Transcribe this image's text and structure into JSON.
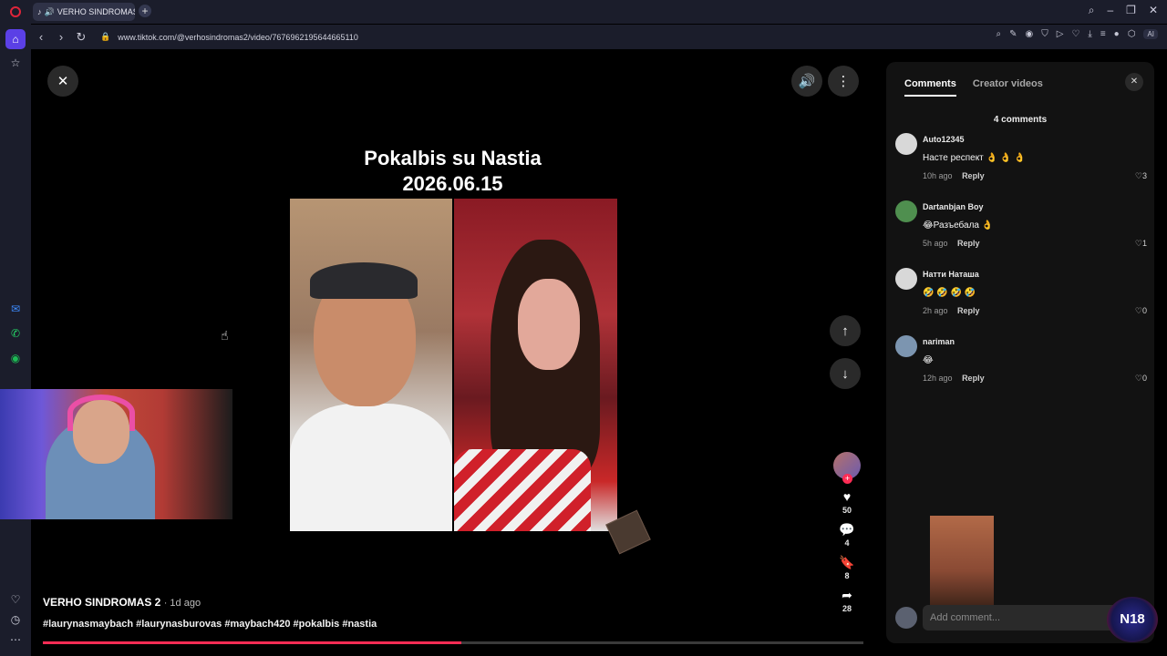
{
  "browser": {
    "tab_title": "VERHO SINDROMAS",
    "url": "www.tiktok.com/@verhosindromas2/video/7676962195644665110",
    "ai_label": "AI"
  },
  "video": {
    "title_line1": "Pokalbis su Nastia",
    "title_line2": "2026.06.15",
    "author": "VERHO SINDROMAS 2",
    "posted": "· 1d ago",
    "hashtags": "#laurynasmaybach #laurynasburovas #maybach420 #pokalbis #nastia",
    "progress": 0.51
  },
  "actions": {
    "likes": "50",
    "comments": "4",
    "saves": "8",
    "shares": "28"
  },
  "comments_panel": {
    "tab_comments": "Comments",
    "tab_creator": "Creator videos",
    "count_label": "4 comments",
    "reply_label": "Reply",
    "input_placeholder": "Add comment...",
    "items": [
      {
        "name": "Auto12345",
        "text": "Насте респект 👌 👌 👌",
        "time": "10h ago",
        "likes": "3"
      },
      {
        "name": "Dartanbjan Boy",
        "text": "😂Разъебала 👌",
        "time": "5h ago",
        "likes": "1"
      },
      {
        "name": "Натти Наташа",
        "text": "🤣 🤣 🤣 🤣",
        "time": "2h ago",
        "likes": "0"
      },
      {
        "name": "nariman",
        "text": "😂",
        "time": "12h ago",
        "likes": "0"
      }
    ]
  },
  "overlay_badge": "N18",
  "colors": {
    "accent": "#fe2c55",
    "browser_accent": "#5b40e6"
  }
}
